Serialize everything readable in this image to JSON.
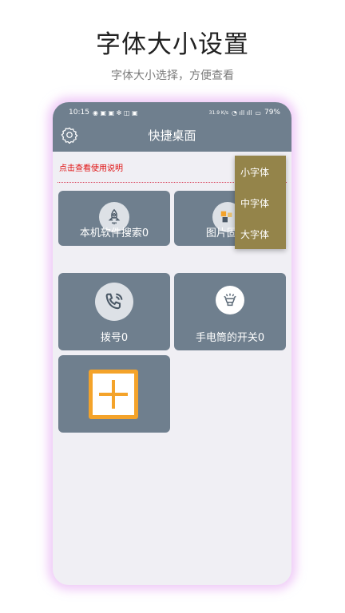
{
  "promo": {
    "title": "字体大小设置",
    "subtitle": "字体大小选择，方便查看"
  },
  "status_bar": {
    "time": "10:15",
    "speed": "31.9 K/s",
    "battery": "79%"
  },
  "app_bar": {
    "title": "快捷桌面",
    "settings_icon": "gear-icon"
  },
  "help_link": "点击查看使用说明",
  "tiles": [
    {
      "label": "本机软件搜索0",
      "icon": "rocket-icon"
    },
    {
      "label": "图片固定0",
      "icon": "image-pin-icon"
    },
    {
      "label": "拨号0",
      "icon": "phone-icon"
    },
    {
      "label": "手电筒的开关0",
      "icon": "flashlight-icon"
    },
    {
      "label": "",
      "icon": "add-icon"
    }
  ],
  "font_menu": {
    "options": [
      "小字体",
      "中字体",
      "大字体"
    ]
  },
  "colors": {
    "bar": "#6f7f8e",
    "tile": "#6f7f8e",
    "menu": "#94844a",
    "add_accent": "#f4a32a",
    "help_text": "#e01010",
    "glow": "#e2a0f0"
  }
}
